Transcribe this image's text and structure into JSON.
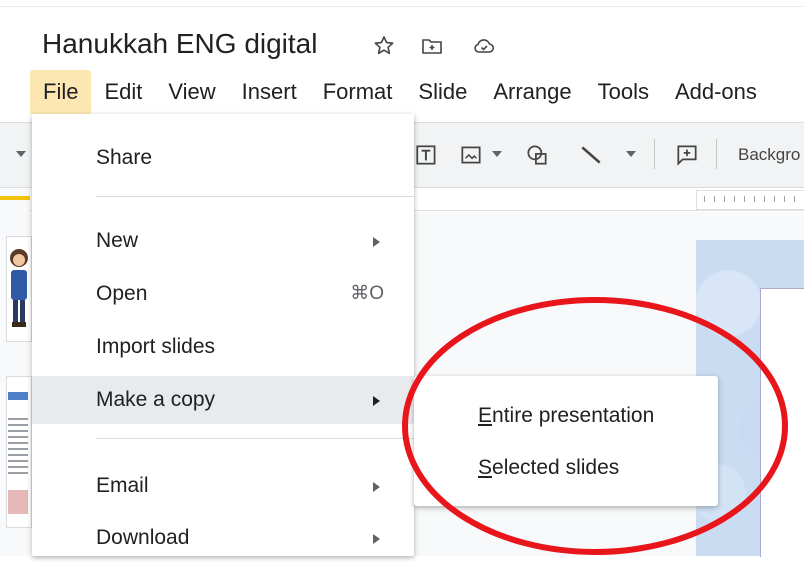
{
  "document": {
    "title": "Hanukkah ENG digital"
  },
  "title_icons": [
    "star-icon",
    "move-to-folder-icon",
    "cloud-saved-icon"
  ],
  "menubar": {
    "items": [
      {
        "label": "File",
        "active": true
      },
      {
        "label": "Edit"
      },
      {
        "label": "View"
      },
      {
        "label": "Insert"
      },
      {
        "label": "Format"
      },
      {
        "label": "Slide"
      },
      {
        "label": "Arrange"
      },
      {
        "label": "Tools"
      },
      {
        "label": "Add-ons"
      }
    ]
  },
  "toolbar": {
    "background_label": "Backgro"
  },
  "file_menu": {
    "share": "Share",
    "new": "New",
    "open": "Open",
    "open_shortcut": "⌘O",
    "import_slides": "Import slides",
    "make_a_copy": "Make a copy",
    "email": "Email",
    "download": "Download"
  },
  "submenu": {
    "entire_first": "E",
    "entire_rest": "ntire presentation",
    "selected_first": "S",
    "selected_rest": "elected slides"
  },
  "colors": {
    "menu_active_bg": "#fce7b3",
    "hover_bg": "#e8eaed",
    "annotation": "#e8151b"
  }
}
